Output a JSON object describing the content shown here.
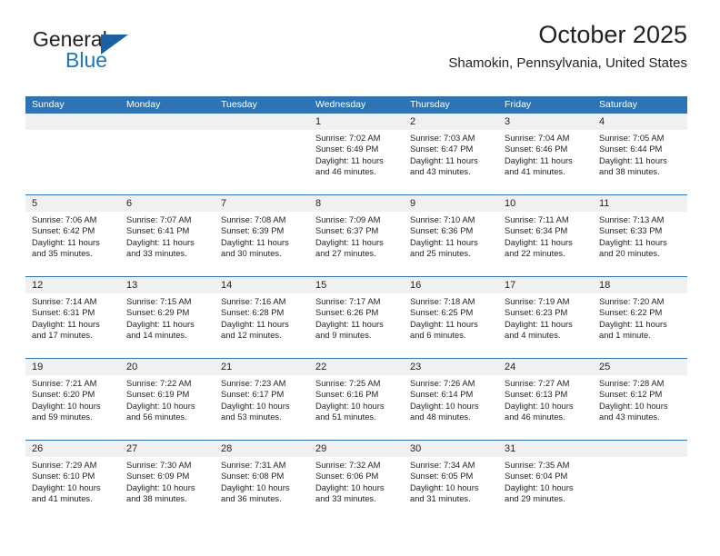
{
  "logo": {
    "primary_text": "General",
    "secondary_text": "Blue",
    "accent_color": "#1b75bb",
    "triangle_color": "#1b5fa5"
  },
  "header": {
    "title": "October 2025",
    "subtitle": "Shamokin, Pennsylvania, United States"
  },
  "theme": {
    "header_row_bg": "#2e74b5",
    "daynum_bg": "#f0f0f0",
    "row_divider": "#2e74b5",
    "text": "#231f20"
  },
  "weekdays": [
    "Sunday",
    "Monday",
    "Tuesday",
    "Wednesday",
    "Thursday",
    "Friday",
    "Saturday"
  ],
  "weeks": [
    [
      {
        "day": "",
        "sunrise": "",
        "sunset": "",
        "daylight": "",
        "empty": true
      },
      {
        "day": "",
        "sunrise": "",
        "sunset": "",
        "daylight": "",
        "empty": true
      },
      {
        "day": "",
        "sunrise": "",
        "sunset": "",
        "daylight": "",
        "empty": true
      },
      {
        "day": "1",
        "sunrise": "Sunrise: 7:02 AM",
        "sunset": "Sunset: 6:49 PM",
        "daylight": "Daylight: 11 hours and 46 minutes."
      },
      {
        "day": "2",
        "sunrise": "Sunrise: 7:03 AM",
        "sunset": "Sunset: 6:47 PM",
        "daylight": "Daylight: 11 hours and 43 minutes."
      },
      {
        "day": "3",
        "sunrise": "Sunrise: 7:04 AM",
        "sunset": "Sunset: 6:46 PM",
        "daylight": "Daylight: 11 hours and 41 minutes."
      },
      {
        "day": "4",
        "sunrise": "Sunrise: 7:05 AM",
        "sunset": "Sunset: 6:44 PM",
        "daylight": "Daylight: 11 hours and 38 minutes."
      }
    ],
    [
      {
        "day": "5",
        "sunrise": "Sunrise: 7:06 AM",
        "sunset": "Sunset: 6:42 PM",
        "daylight": "Daylight: 11 hours and 35 minutes."
      },
      {
        "day": "6",
        "sunrise": "Sunrise: 7:07 AM",
        "sunset": "Sunset: 6:41 PM",
        "daylight": "Daylight: 11 hours and 33 minutes."
      },
      {
        "day": "7",
        "sunrise": "Sunrise: 7:08 AM",
        "sunset": "Sunset: 6:39 PM",
        "daylight": "Daylight: 11 hours and 30 minutes."
      },
      {
        "day": "8",
        "sunrise": "Sunrise: 7:09 AM",
        "sunset": "Sunset: 6:37 PM",
        "daylight": "Daylight: 11 hours and 27 minutes."
      },
      {
        "day": "9",
        "sunrise": "Sunrise: 7:10 AM",
        "sunset": "Sunset: 6:36 PM",
        "daylight": "Daylight: 11 hours and 25 minutes."
      },
      {
        "day": "10",
        "sunrise": "Sunrise: 7:11 AM",
        "sunset": "Sunset: 6:34 PM",
        "daylight": "Daylight: 11 hours and 22 minutes."
      },
      {
        "day": "11",
        "sunrise": "Sunrise: 7:13 AM",
        "sunset": "Sunset: 6:33 PM",
        "daylight": "Daylight: 11 hours and 20 minutes."
      }
    ],
    [
      {
        "day": "12",
        "sunrise": "Sunrise: 7:14 AM",
        "sunset": "Sunset: 6:31 PM",
        "daylight": "Daylight: 11 hours and 17 minutes."
      },
      {
        "day": "13",
        "sunrise": "Sunrise: 7:15 AM",
        "sunset": "Sunset: 6:29 PM",
        "daylight": "Daylight: 11 hours and 14 minutes."
      },
      {
        "day": "14",
        "sunrise": "Sunrise: 7:16 AM",
        "sunset": "Sunset: 6:28 PM",
        "daylight": "Daylight: 11 hours and 12 minutes."
      },
      {
        "day": "15",
        "sunrise": "Sunrise: 7:17 AM",
        "sunset": "Sunset: 6:26 PM",
        "daylight": "Daylight: 11 hours and 9 minutes."
      },
      {
        "day": "16",
        "sunrise": "Sunrise: 7:18 AM",
        "sunset": "Sunset: 6:25 PM",
        "daylight": "Daylight: 11 hours and 6 minutes."
      },
      {
        "day": "17",
        "sunrise": "Sunrise: 7:19 AM",
        "sunset": "Sunset: 6:23 PM",
        "daylight": "Daylight: 11 hours and 4 minutes."
      },
      {
        "day": "18",
        "sunrise": "Sunrise: 7:20 AM",
        "sunset": "Sunset: 6:22 PM",
        "daylight": "Daylight: 11 hours and 1 minute."
      }
    ],
    [
      {
        "day": "19",
        "sunrise": "Sunrise: 7:21 AM",
        "sunset": "Sunset: 6:20 PM",
        "daylight": "Daylight: 10 hours and 59 minutes."
      },
      {
        "day": "20",
        "sunrise": "Sunrise: 7:22 AM",
        "sunset": "Sunset: 6:19 PM",
        "daylight": "Daylight: 10 hours and 56 minutes."
      },
      {
        "day": "21",
        "sunrise": "Sunrise: 7:23 AM",
        "sunset": "Sunset: 6:17 PM",
        "daylight": "Daylight: 10 hours and 53 minutes."
      },
      {
        "day": "22",
        "sunrise": "Sunrise: 7:25 AM",
        "sunset": "Sunset: 6:16 PM",
        "daylight": "Daylight: 10 hours and 51 minutes."
      },
      {
        "day": "23",
        "sunrise": "Sunrise: 7:26 AM",
        "sunset": "Sunset: 6:14 PM",
        "daylight": "Daylight: 10 hours and 48 minutes."
      },
      {
        "day": "24",
        "sunrise": "Sunrise: 7:27 AM",
        "sunset": "Sunset: 6:13 PM",
        "daylight": "Daylight: 10 hours and 46 minutes."
      },
      {
        "day": "25",
        "sunrise": "Sunrise: 7:28 AM",
        "sunset": "Sunset: 6:12 PM",
        "daylight": "Daylight: 10 hours and 43 minutes."
      }
    ],
    [
      {
        "day": "26",
        "sunrise": "Sunrise: 7:29 AM",
        "sunset": "Sunset: 6:10 PM",
        "daylight": "Daylight: 10 hours and 41 minutes."
      },
      {
        "day": "27",
        "sunrise": "Sunrise: 7:30 AM",
        "sunset": "Sunset: 6:09 PM",
        "daylight": "Daylight: 10 hours and 38 minutes."
      },
      {
        "day": "28",
        "sunrise": "Sunrise: 7:31 AM",
        "sunset": "Sunset: 6:08 PM",
        "daylight": "Daylight: 10 hours and 36 minutes."
      },
      {
        "day": "29",
        "sunrise": "Sunrise: 7:32 AM",
        "sunset": "Sunset: 6:06 PM",
        "daylight": "Daylight: 10 hours and 33 minutes."
      },
      {
        "day": "30",
        "sunrise": "Sunrise: 7:34 AM",
        "sunset": "Sunset: 6:05 PM",
        "daylight": "Daylight: 10 hours and 31 minutes."
      },
      {
        "day": "31",
        "sunrise": "Sunrise: 7:35 AM",
        "sunset": "Sunset: 6:04 PM",
        "daylight": "Daylight: 10 hours and 29 minutes."
      },
      {
        "day": "",
        "sunrise": "",
        "sunset": "",
        "daylight": "",
        "empty": true
      }
    ]
  ]
}
